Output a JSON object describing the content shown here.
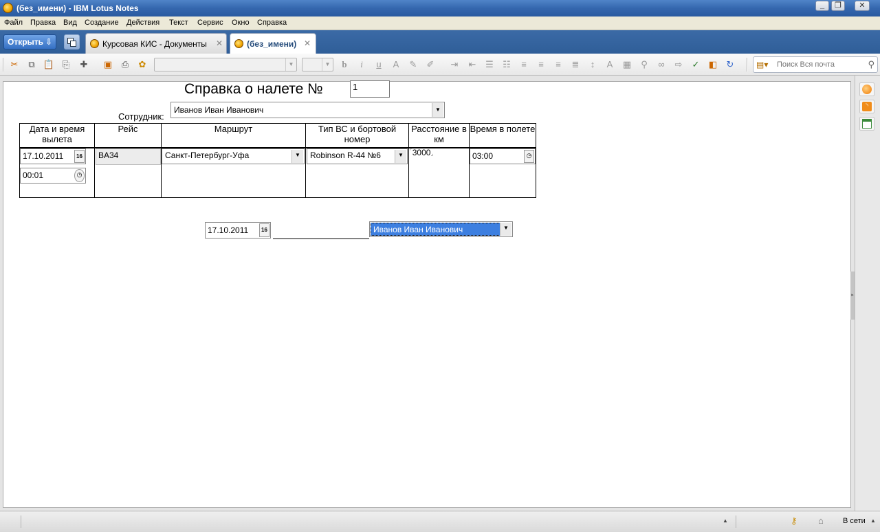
{
  "window": {
    "title": "(без_имени) - IBM Lotus Notes",
    "controls": {
      "minimize": "_",
      "restore": "❐",
      "close": "✕"
    }
  },
  "menu": [
    "Файл",
    "Правка",
    "Вид",
    "Создание",
    "Действия",
    "Текст",
    "Сервис",
    "Окно",
    "Справка"
  ],
  "tabbar": {
    "open_label": "Открыть",
    "tabs": [
      {
        "label": "Курсовая КИС - Документы",
        "active": false
      },
      {
        "label": "(без_имени)",
        "active": true
      }
    ]
  },
  "toolbar": {
    "search_placeholder": "Поиск Вся почта"
  },
  "form": {
    "title": "Справка о налете №",
    "number": "1",
    "employee_label": "Сотрудник:",
    "employee": "Иванов Иван Иванович",
    "table": {
      "headers": [
        "Дата и время вылета",
        "Рейс",
        "Маршрут",
        "Тип ВС и бортовой номер",
        "Расстояние в км",
        "Время в полете"
      ],
      "row": {
        "date": "17.10.2011",
        "time": "00:01",
        "flight": "BA34",
        "route": "Санкт-Петербург-Уфа",
        "aircraft": "Robinson R-44 №6",
        "distance": "3000",
        "flight_time": "03:00"
      }
    },
    "footer": {
      "date": "17.10.2011",
      "signer": "Иванов Иван Иванович"
    }
  },
  "calendar_glyph": "16",
  "statusbar": {
    "network": "В сети"
  }
}
